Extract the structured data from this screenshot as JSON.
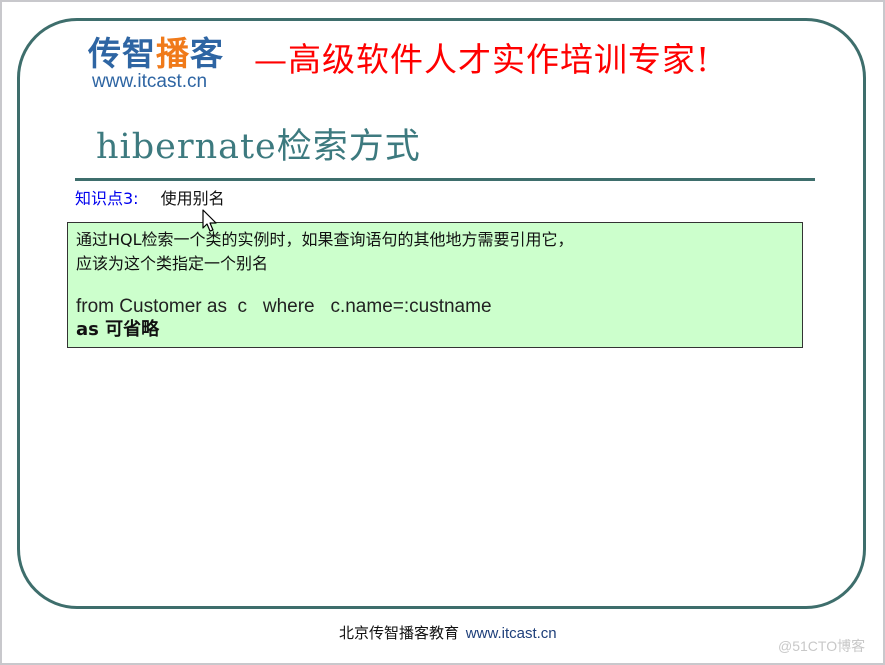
{
  "header": {
    "logo_cn_part1": "传智",
    "logo_cn_highlight": "播",
    "logo_cn_part2": "客",
    "logo_url": "www.itcast.cn",
    "slogan": "—高级软件人才实作培训专家!"
  },
  "slide": {
    "title": "hibernate检索方式",
    "knowledge_point_label": "知识点3:",
    "knowledge_point_text": "使用别名",
    "box": {
      "line1": "通过HQL检索一个类的实例时，如果查询语句的其他地方需要引用它，",
      "line2": "应该为这个类指定一个别名",
      "code": "from Customer as  c   where   c.name=:custname",
      "note": "as 可省略"
    }
  },
  "footer": {
    "org": "北京传智播客教育",
    "url": "www.itcast.cn"
  },
  "watermark": "@51CTO博客",
  "colors": {
    "frame": "#3e6e6c",
    "slogan": "#ff0000",
    "logo_blue": "#2e65a3",
    "logo_orange": "#f07a1a",
    "title": "#3d7a7f",
    "kp_label": "#0000ee",
    "box_bg": "#ccffcc"
  }
}
